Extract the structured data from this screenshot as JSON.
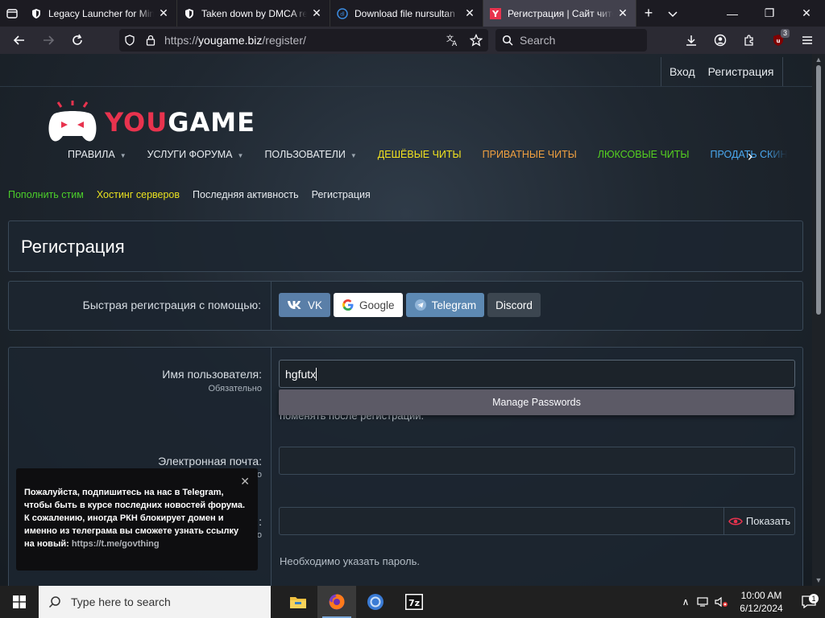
{
  "browser": {
    "tabs": [
      {
        "title": "Legacy Launcher for Mine",
        "icon": "shield-icon",
        "active": false
      },
      {
        "title": "Taken down by DMCA req",
        "icon": "shield-icon",
        "active": false
      },
      {
        "title": "Download file nursultan",
        "icon": "file-site-icon",
        "active": false
      },
      {
        "title": "Регистрация | Сайт чито",
        "icon": "yougame-favicon",
        "active": true
      }
    ],
    "url_prefix": "https://",
    "url_host": "yougame.biz",
    "url_path": "/register/",
    "search_placeholder": "Search",
    "extension_badge": "3"
  },
  "site": {
    "account": {
      "login": "Вход",
      "register": "Регистрация"
    },
    "logo": {
      "you": "YOU",
      "game": "GAME"
    },
    "main_nav": [
      {
        "label": "ПРАВИЛА",
        "caret": true,
        "color": "#e8ecf0"
      },
      {
        "label": "УСЛУГИ ФОРУМА",
        "caret": true,
        "color": "#e8ecf0"
      },
      {
        "label": "ПОЛЬЗОВАТЕЛИ",
        "caret": true,
        "color": "#e8ecf0"
      },
      {
        "label": "ДЕШЁВЫЕ ЧИТЫ",
        "caret": false,
        "color": "#f2e21f"
      },
      {
        "label": "ПРИВАТНЫЕ ЧИТЫ",
        "caret": false,
        "color": "#f0a040"
      },
      {
        "label": "ЛЮКСОВЫЕ ЧИТЫ",
        "caret": false,
        "color": "#55d020"
      },
      {
        "label": "ПРОДАТЬ СКИН",
        "caret": false,
        "color": "#4aa8f0"
      }
    ],
    "sub_nav": [
      {
        "label": "Пополнить стим",
        "color": "#4ccf2a"
      },
      {
        "label": "Хостинг серверов",
        "color": "#e8e020"
      },
      {
        "label": "Последняя активность",
        "color": "#e8ecf0"
      },
      {
        "label": "Регистрация",
        "color": "#e8ecf0"
      }
    ],
    "page_title": "Регистрация",
    "quick_register": {
      "label": "Быстрая регистрация с помощью:",
      "buttons": [
        "VK",
        "Google",
        "Telegram",
        "Discord"
      ]
    },
    "form": {
      "username_label": "Имя пользователя:",
      "username_required": "Обязательно",
      "username_value": "hgfutx",
      "username_hint": "поменять после регистрации.",
      "email_label": "Электронная почта:",
      "email_required_partial": "о",
      "password_label_partial": ":",
      "password_required_partial": "о",
      "password_show": "Показать",
      "password_hint": "Необходимо указать пароль."
    },
    "autofill_popup": "Manage Passwords",
    "toast": {
      "text": "Пожалуйста, подпишитесь на нас в Telegram, чтобы быть в курсе последних новостей форума. К сожалению, иногда РКН блокирует домен и именно из телеграма вы сможете узнать ссылку на новый:",
      "link": "https://t.me/govthing"
    }
  },
  "taskbar": {
    "search_placeholder": "Type here to search",
    "time": "10:00 AM",
    "date": "6/12/2024",
    "notifications": "1"
  }
}
